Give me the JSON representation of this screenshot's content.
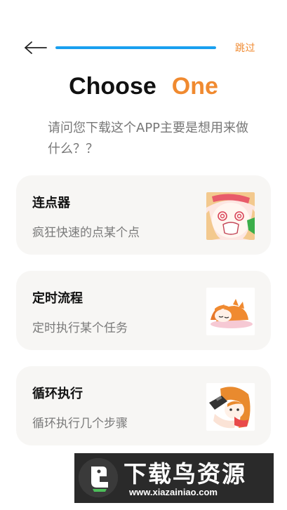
{
  "header": {
    "back_icon": "arrow-left-icon",
    "progress": 1.0,
    "skip_label": "跳过"
  },
  "title": {
    "word1": "Choose",
    "word2": "One"
  },
  "subtitle": "请问您下载这个APP主要是想用来做什么？？",
  "options": [
    {
      "title": "连点器",
      "desc": "疯狂快速的点某个点",
      "image": "anime-girl-shocked"
    },
    {
      "title": "定时流程",
      "desc": "定时执行某个任务",
      "image": "anime-girl-sleeping"
    },
    {
      "title": "循环执行",
      "desc": "循环执行几个步骤",
      "image": "anime-girl-gaming"
    }
  ],
  "watermark": {
    "text": "下载鸟资源",
    "url": "www.xiazainiao.com"
  },
  "colors": {
    "accent": "#f08a30",
    "progress": "#19a0f0",
    "card_bg": "#f7f6f4"
  }
}
